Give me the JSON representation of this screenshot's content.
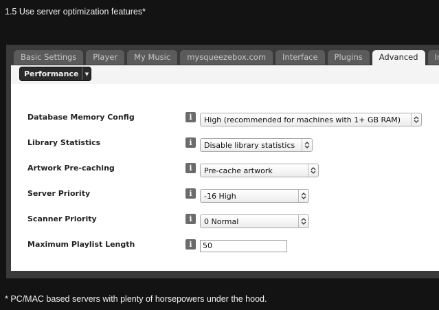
{
  "heading": "1.5  Use server optimization features*",
  "footnote": "* PC/MAC based servers with plenty of horsepowers under the hood.",
  "tabs": [
    {
      "label": "Basic Settings"
    },
    {
      "label": "Player"
    },
    {
      "label": "My Music"
    },
    {
      "label": "mysqueezebox.com"
    },
    {
      "label": "Interface"
    },
    {
      "label": "Plugins"
    },
    {
      "label": "Advanced"
    },
    {
      "label": "Info"
    }
  ],
  "active_tab": "Advanced",
  "section_menu": {
    "label": "Performance",
    "icon": "chevron-down-icon"
  },
  "settings": [
    {
      "label": "Database Memory Config",
      "value": "High (recommended for machines with 1+ GB RAM)",
      "type": "select"
    },
    {
      "label": "Library Statistics",
      "value": "Disable library statistics",
      "type": "select"
    },
    {
      "label": "Artwork Pre-caching",
      "value": "Pre-cache artwork",
      "type": "select"
    },
    {
      "label": "Server Priority",
      "value": "-16 High",
      "type": "select"
    },
    {
      "label": "Scanner Priority",
      "value": "0 Normal",
      "type": "select"
    },
    {
      "label": "Maximum Playlist Length",
      "value": "50",
      "type": "text"
    }
  ],
  "info_icon_glyph": "i",
  "colors": {
    "page_bg": "#131313",
    "frame": "#3a3a3a",
    "tab": "#5b5b5b",
    "panel": "#ffffff",
    "info": "#6b6b6b"
  }
}
